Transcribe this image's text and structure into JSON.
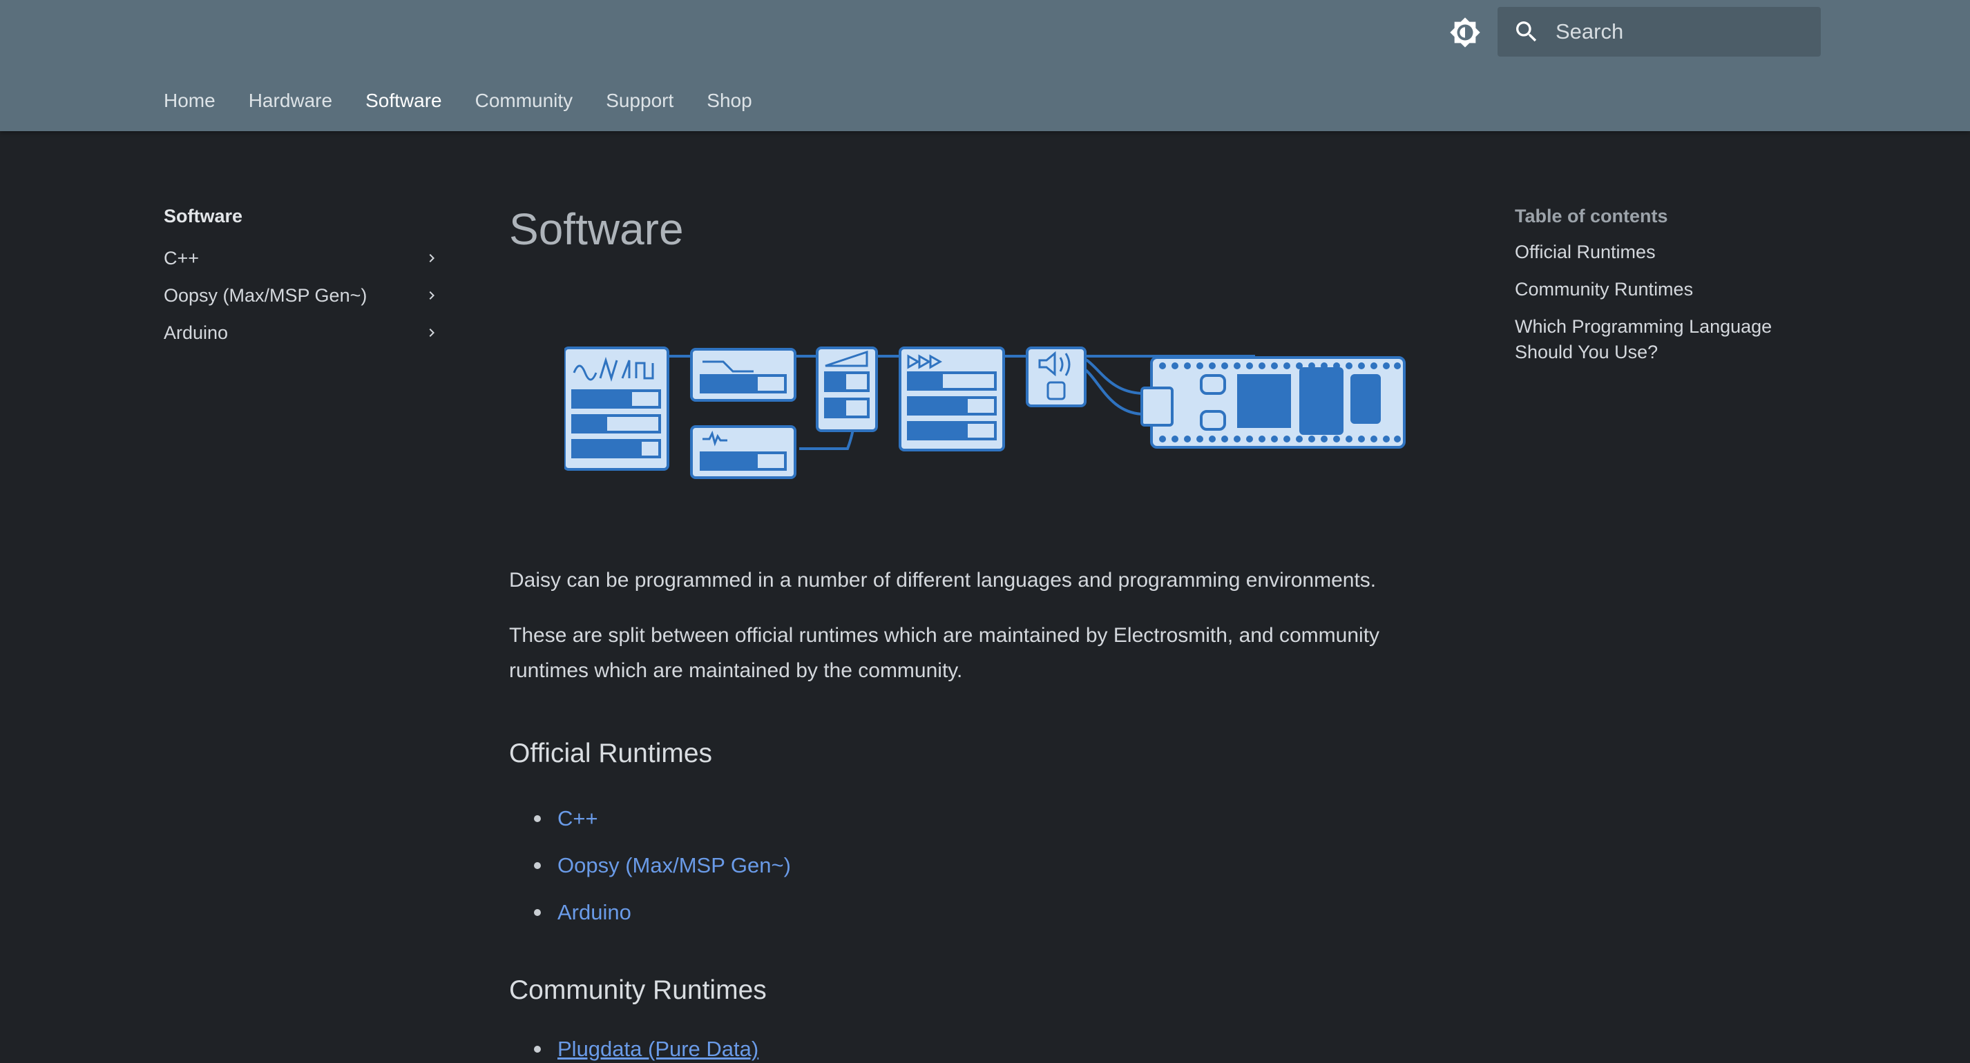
{
  "header": {
    "search_placeholder": "Search",
    "nav": [
      {
        "label": "Home"
      },
      {
        "label": "Hardware"
      },
      {
        "label": "Software"
      },
      {
        "label": "Community"
      },
      {
        "label": "Support"
      },
      {
        "label": "Shop"
      }
    ],
    "active_nav": "Software"
  },
  "sidebar": {
    "title": "Software",
    "items": [
      {
        "label": "C++"
      },
      {
        "label": "Oopsy (Max/MSP Gen~)"
      },
      {
        "label": "Arduino"
      }
    ]
  },
  "main": {
    "title": "Software",
    "intro": "Daisy can be programmed in a number of different languages and programming environments.",
    "intro2": "These are split between official runtimes which are maintained by Electrosmith, and community runtimes which are maintained by the community.",
    "official_heading": "Official Runtimes",
    "official_links": [
      {
        "label": "C++"
      },
      {
        "label": "Oopsy (Max/MSP Gen~)"
      },
      {
        "label": "Arduino"
      }
    ],
    "community_heading": "Community Runtimes",
    "community_links": [
      {
        "label": "Plugdata (Pure Data)"
      }
    ]
  },
  "toc": {
    "title": "Table of contents",
    "items": [
      {
        "label": "Official Runtimes"
      },
      {
        "label": "Community Runtimes"
      },
      {
        "label": "Which Programming Language Should You Use?"
      }
    ]
  },
  "colors": {
    "header_bg": "#5b6f7c",
    "page_bg": "#1f2226",
    "link": "#6a9be8",
    "illustration_fill": "#cfe2f6",
    "illustration_stroke": "#2f73c0"
  }
}
